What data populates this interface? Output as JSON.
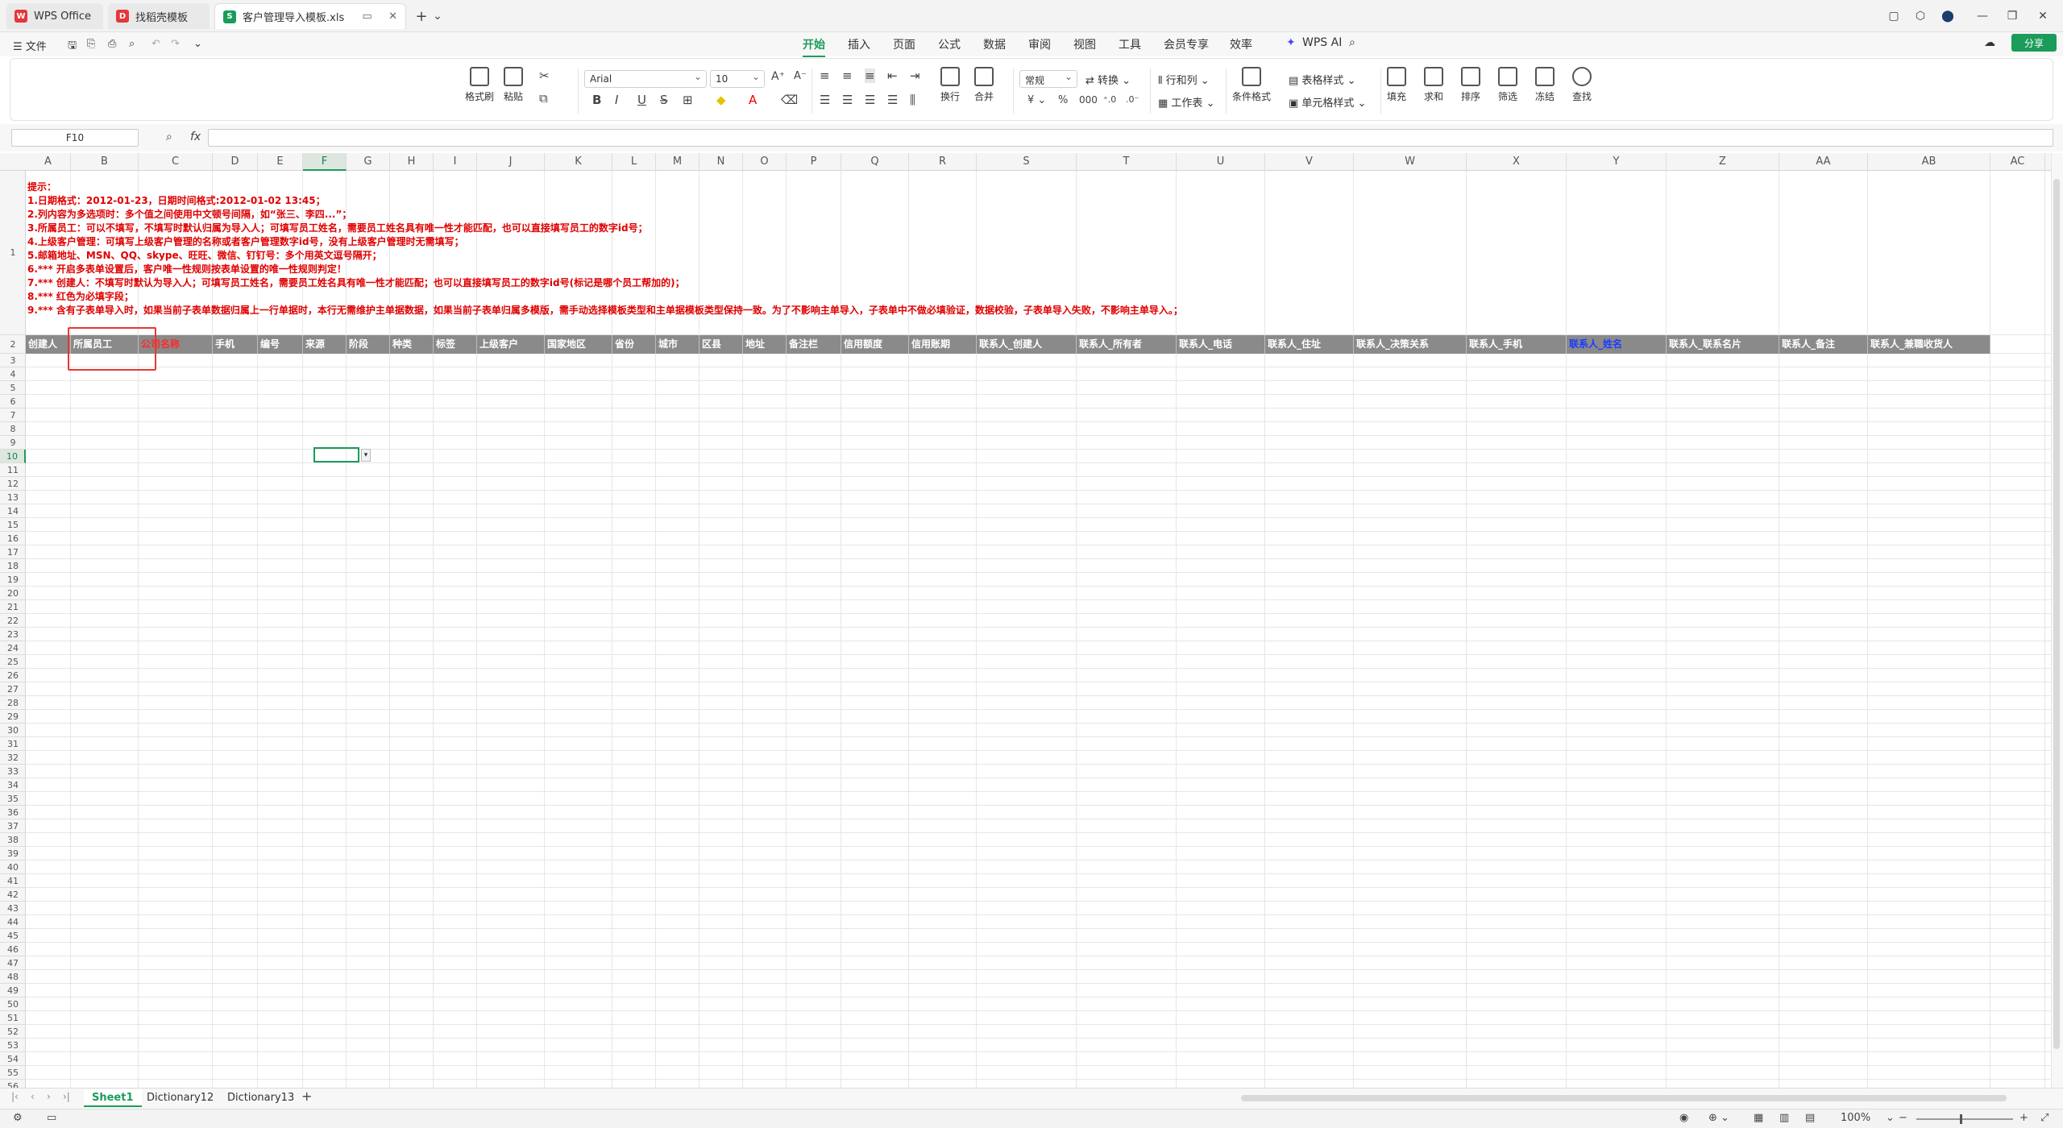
{
  "tabs": [
    {
      "label": "WPS Office",
      "icon": "W",
      "color": "#e5373a"
    },
    {
      "label": "找稻壳模板",
      "icon": "D",
      "color": "#e5373a"
    },
    {
      "label": "客户管理导入模板.xls",
      "icon": "S",
      "color": "#1b9c5a"
    }
  ],
  "tab_close": "✕",
  "tab_extra": "▭",
  "new_tab": "+",
  "tab_menu": "⌄",
  "menu": {
    "file": "☰ 文件",
    "ribbon_tabs": [
      "开始",
      "插入",
      "页面",
      "公式",
      "数据",
      "审阅",
      "视图",
      "工具",
      "会员专享",
      "效率"
    ],
    "active_tab": "开始",
    "ai": "WPS AI",
    "share": "分享"
  },
  "ribbon": {
    "format_painter": "格式刷",
    "paste": "粘贴",
    "font_name": "Arial",
    "font_size": "10",
    "wrap": "换行",
    "merge": "合并",
    "number_format": "常规",
    "convert": "转换",
    "row_col": "行和列",
    "worksheet": "工作表",
    "cond_format": "条件格式",
    "table_style": "表格样式",
    "cell_style": "单元格样式",
    "fill": "填充",
    "sum": "求和",
    "sort": "排序",
    "filter": "筛选",
    "freeze": "冻结",
    "find": "查找",
    "bold": "B",
    "italic": "I",
    "underline": "U"
  },
  "formula": {
    "namebox": "F10",
    "fx": "fx"
  },
  "columns": [
    "A",
    "B",
    "C",
    "D",
    "E",
    "F",
    "G",
    "H",
    "I",
    "J",
    "K",
    "L",
    "M",
    "N",
    "O",
    "P",
    "Q",
    "R",
    "S",
    "T",
    "U",
    "V",
    "W",
    "X",
    "Y",
    "Z",
    "AA",
    "AB",
    "AC"
  ],
  "selected_column": "F",
  "notes": [
    "提示：",
    "1.日期格式：2012-01-23，日期时间格式:2012-01-02 13:45；",
    "2.列内容为多选项时：多个值之间使用中文顿号间隔，如“张三、李四...”；",
    "3.所属员工：可以不填写，不填写时默认归属为导入人；可填写员工姓名，需要员工姓名具有唯一性才能匹配，也可以直接填写员工的数字id号；",
    "4.上级客户管理：可填写上级客户管理的名称或者客户管理数字id号，没有上级客户管理时无需填写；",
    "5.邮箱地址、MSN、QQ、skype、旺旺、微信、钉钉号：多个用英文逗号隔开；",
    "6.*** 开启多表单设置后，客户唯一性规则按表单设置的唯一性规则判定！",
    "7.*** 创建人：不填写时默认为导入人；可填写员工姓名，需要员工姓名具有唯一性才能匹配；也可以直接填写员工的数字id号(标记是哪个员工帮加的)；",
    "8.*** 红色为必填字段；",
    "9.*** 含有子表单导入时，如果当前子表单数据归属上一行单据时，本行无需维护主单据数据，如果当前子表单归属多模版，需手动选择模板类型和主单据模板类型保持一致。为了不影响主单导入，子表单中不做必填验证，数据校验，子表单导入失败，不影响主单导入。；"
  ],
  "headers": [
    "创建人",
    "所属员工",
    "公司名称",
    "手机",
    "编号",
    "来源",
    "阶段",
    "种类",
    "标签",
    "上级客户",
    "国家地区",
    "省份",
    "城市",
    "区县",
    "地址",
    "备注栏",
    "信用额度",
    "信用账期",
    "联系人_创建人",
    "联系人_所有者",
    "联系人_电话",
    "联系人_住址",
    "联系人_决策关系",
    "联系人_手机",
    "联系人_姓名",
    "联系人_联系名片",
    "联系人_备注",
    "联系人_兼職收货人"
  ],
  "header_colors": {
    "required": "#ff2a2a",
    "link": "#1a3dff"
  },
  "sheets": [
    "Sheet1",
    "Dictionary12",
    "Dictionary13"
  ],
  "active_sheet": "Sheet1",
  "add_sheet": "+",
  "status": {
    "zoom": "100%",
    "zoom_minus": "−",
    "zoom_plus": "+"
  },
  "dropdown_arrow": "▾",
  "win_buttons": [
    "▢",
    "⬡",
    "⬤",
    "—",
    "❐",
    "✕"
  ]
}
